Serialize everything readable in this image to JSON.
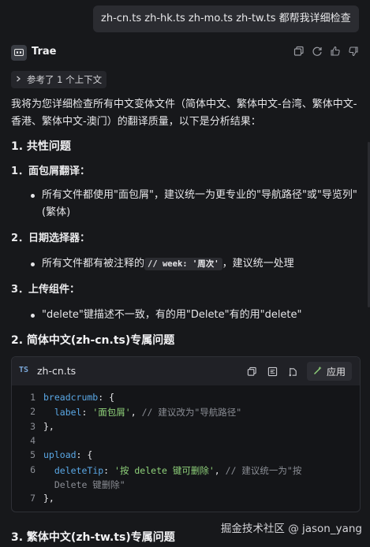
{
  "user_message": "zh-cn.ts zh-hk.ts  zh-mo.ts  zh-tw.ts 都帮我详细检查",
  "assistant": {
    "name": "Trae"
  },
  "header_icons": [
    "copy-icon",
    "refresh-icon",
    "thumbs-up-icon",
    "thumbs-down-icon"
  ],
  "reference": {
    "label": "参考了 1 个上下文"
  },
  "intro": "我将为您详细检查所有中文变体文件（简体中文、繁体中文-台湾、繁体中文-香港、繁体中文-澳门）的翻译质量，以下是分析结果：",
  "sections": {
    "s1_title": "1. 共性问题",
    "s1_item1_title": "1．面包屑翻译：",
    "s1_item1_bullet": "所有文件都使用\"面包屑\"，建议统一为更专业的\"导航路径\"或\"导览列\"(繁体)",
    "s1_item2_title": "2．日期选择器：",
    "s1_item2_bullet_pre": "所有文件都有被注释的",
    "s1_item2_code": "// week: '周次'",
    "s1_item2_bullet_post": "，建议统一处理",
    "s1_item3_title": "3．上传组件：",
    "s1_item3_bullet": "\"delete\"键描述不一致，有的用\"Delete\"有的用\"delete\"",
    "s2_title": "2. 简体中文(zh-cn.ts)专属问题",
    "s3_title": "3. 繁体中文(zh-tw.ts)专属问题"
  },
  "code_block": {
    "lang": "TS",
    "filename": "zh-cn.ts",
    "apply_label": "应用",
    "lines": [
      {
        "n": "1",
        "parts": [
          [
            "key",
            "breadcrumb"
          ],
          [
            "pun",
            ": {"
          ]
        ]
      },
      {
        "n": "2",
        "parts": [
          [
            "pun",
            "  "
          ],
          [
            "key",
            "label"
          ],
          [
            "pun",
            ": "
          ],
          [
            "str",
            "'面包屑'"
          ],
          [
            "pun",
            ", "
          ],
          [
            "com",
            "// 建议改为\"导航路径\""
          ]
        ]
      },
      {
        "n": "3",
        "parts": [
          [
            "pun",
            "},"
          ]
        ]
      },
      {
        "n": "4",
        "parts": []
      },
      {
        "n": "5",
        "parts": [
          [
            "key",
            "upload"
          ],
          [
            "pun",
            ": {"
          ]
        ]
      },
      {
        "n": "6",
        "parts": [
          [
            "pun",
            "  "
          ],
          [
            "key",
            "deleteTip"
          ],
          [
            "pun",
            ": "
          ],
          [
            "str",
            "'按 delete 键可删除'"
          ],
          [
            "pun",
            ", "
          ],
          [
            "com",
            "// 建议统一为\"按"
          ]
        ]
      },
      {
        "n": "",
        "parts": [
          [
            "com",
            "  Delete 键删除\""
          ]
        ]
      },
      {
        "n": "7",
        "parts": [
          [
            "pun",
            "},"
          ]
        ]
      }
    ]
  },
  "watermark": "掘金技术社区 @ jason_yang"
}
